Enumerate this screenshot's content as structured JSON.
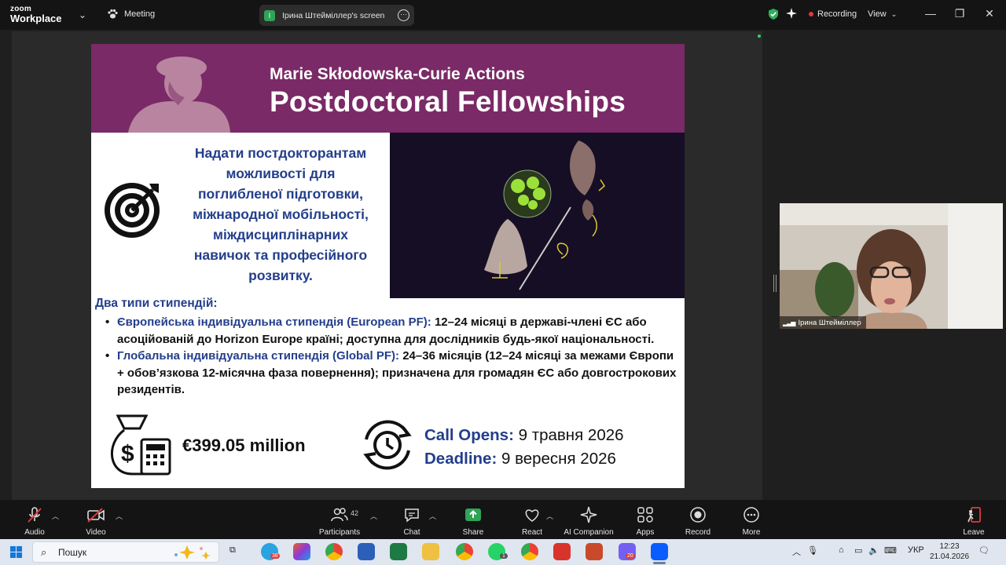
{
  "titlebar": {
    "logo_top": "zoom",
    "logo_bottom": "Workplace",
    "meeting_label": "Meeting",
    "share_badge": "I",
    "share_label": "Ірина Штейміллер's screen",
    "recording_label": "Recording",
    "view_label": "View",
    "minimize": "—",
    "maximize": "❐",
    "close": "✕"
  },
  "slide": {
    "subtitle": "Marie Skłodowska-Curie Actions",
    "title": "Postdoctoral Fellowships",
    "purpose_lines": [
      "Надати постдокторантам",
      "можливості для",
      "поглибленої підготовки,",
      "міжнародної мобільності,",
      "міждисциплінарних",
      "навичок та професійного",
      "розвитку."
    ],
    "types_title": "Два типи стипендій:",
    "bullet1_label": "Європейська індивідуальна стипендія (European PF):",
    "bullet1_text": " 12–24 місяці в державі-члені ЄС або асоційованій до Horizon Europe країні; доступна для дослідників будь-якої національності.",
    "bullet2_label": "Глобальна індивідуальна стипендія (Global PF):",
    "bullet2_text": " 24–36 місяців (12–24 місяці за межами Європи + обов’язкова 12-місячна фаза повернення); призначена для громадян ЄС або довгострокових резидентів.",
    "budget": "€399.05 million",
    "call_opens_label": "Call Opens:",
    "call_opens_value": " 9 травня 2026",
    "deadline_label": "Deadline:",
    "deadline_value": " 9 вересня 2026"
  },
  "participant": {
    "name": "Ірина Штейміллер"
  },
  "toolbar": {
    "audio": "Audio",
    "video": "Video",
    "participants": "Participants",
    "participants_count": "42",
    "chat": "Chat",
    "share": "Share",
    "react": "React",
    "ai_companion": "AI Companion",
    "apps": "Apps",
    "record": "Record",
    "more": "More",
    "leave": "Leave"
  },
  "taskbar": {
    "search_placeholder": "Пошук",
    "language": "УКР",
    "time": "12:23",
    "date": "21.04.2026",
    "badge_telegram": "38",
    "badge_whatsapp": "1",
    "badge_viber": "20"
  },
  "colors": {
    "banner": "#7a2a66",
    "accent_text": "#233e8b",
    "share_green": "#2fa356",
    "recording_red": "#e0393e",
    "leave_red": "#e0393e"
  }
}
